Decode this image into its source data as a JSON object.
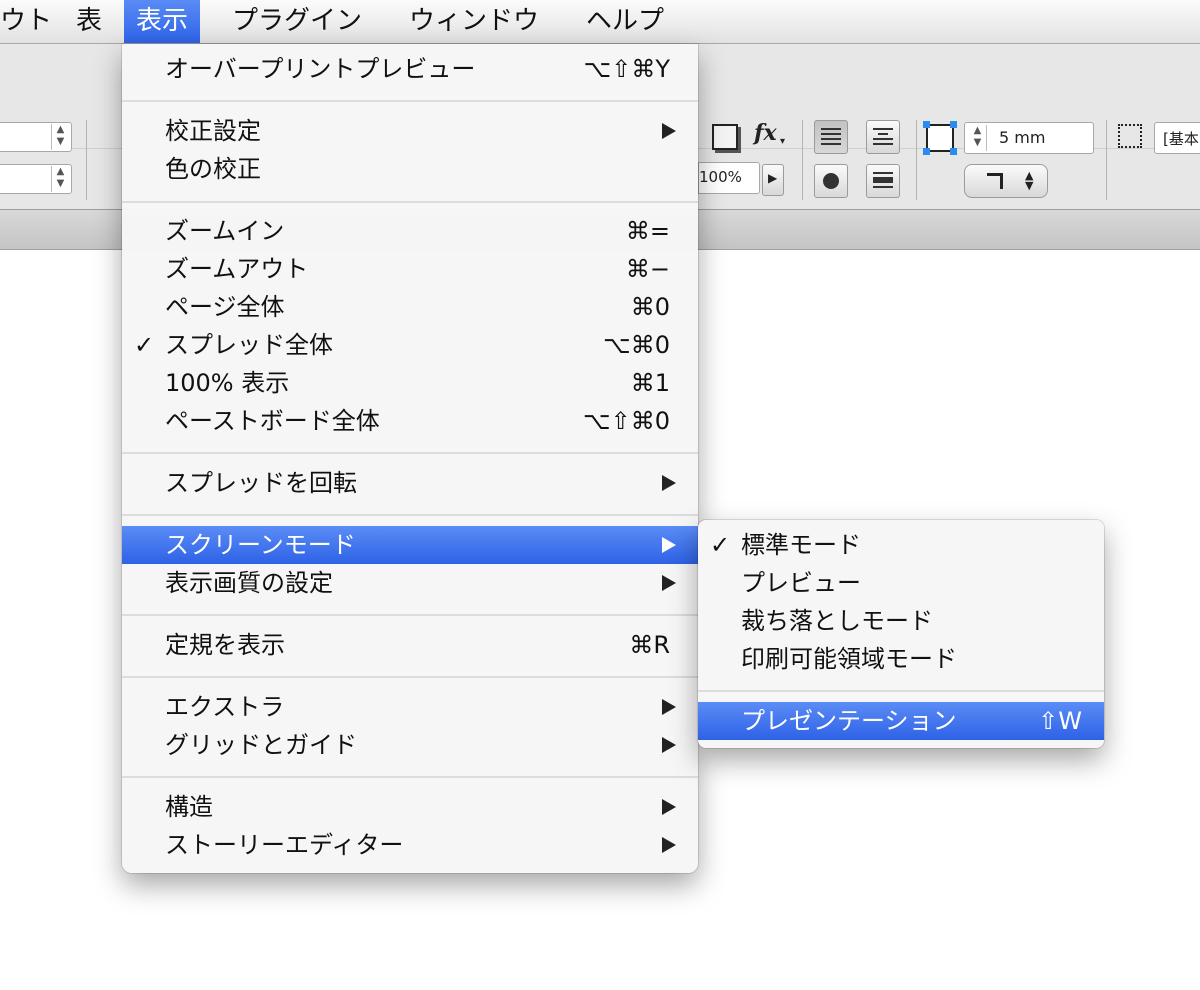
{
  "menubar": {
    "items": [
      {
        "label": "ウト"
      },
      {
        "label": "表"
      },
      {
        "label": "表示"
      },
      {
        "label": "プラグイン"
      },
      {
        "label": "ウィンドウ"
      },
      {
        "label": "ヘルプ"
      }
    ]
  },
  "toolbar": {
    "fx_label": "fx",
    "stroke_weight": "5 mm",
    "opacity": "100%",
    "style_field": "[基本"
  },
  "view_menu": {
    "overprint_preview": {
      "label": "オーバープリントプレビュー",
      "shortcut": "⌥⇧⌘Y"
    },
    "proof_setup": {
      "label": "校正設定"
    },
    "proof_colors": {
      "label": "色の校正"
    },
    "zoom_in": {
      "label": "ズームイン",
      "shortcut": "⌘="
    },
    "zoom_out": {
      "label": "ズームアウト",
      "shortcut": "⌘−"
    },
    "fit_page": {
      "label": "ページ全体",
      "shortcut": "⌘0"
    },
    "fit_spread": {
      "label": "スプレッド全体",
      "shortcut": "⌥⌘0",
      "check": "✓"
    },
    "actual_size": {
      "label": "100% 表示",
      "shortcut": "⌘1"
    },
    "entire_pasteboard": {
      "label": "ペーストボード全体",
      "shortcut": "⌥⇧⌘0"
    },
    "rotate_spread": {
      "label": "スプレッドを回転"
    },
    "screen_mode": {
      "label": "スクリーンモード"
    },
    "display_performance": {
      "label": "表示画質の設定"
    },
    "show_rulers": {
      "label": "定規を表示",
      "shortcut": "⌘R"
    },
    "extras": {
      "label": "エクストラ"
    },
    "grids_guides": {
      "label": "グリッドとガイド"
    },
    "structure": {
      "label": "構造"
    },
    "story_editor": {
      "label": "ストーリーエディター"
    }
  },
  "screen_mode_submenu": {
    "normal": {
      "label": "標準モード",
      "check": "✓"
    },
    "preview": {
      "label": "プレビュー"
    },
    "bleed": {
      "label": "裁ち落としモード"
    },
    "slug": {
      "label": "印刷可能領域モード"
    },
    "presentation": {
      "label": "プレゼンテーション",
      "shortcut": "⇧W"
    }
  }
}
